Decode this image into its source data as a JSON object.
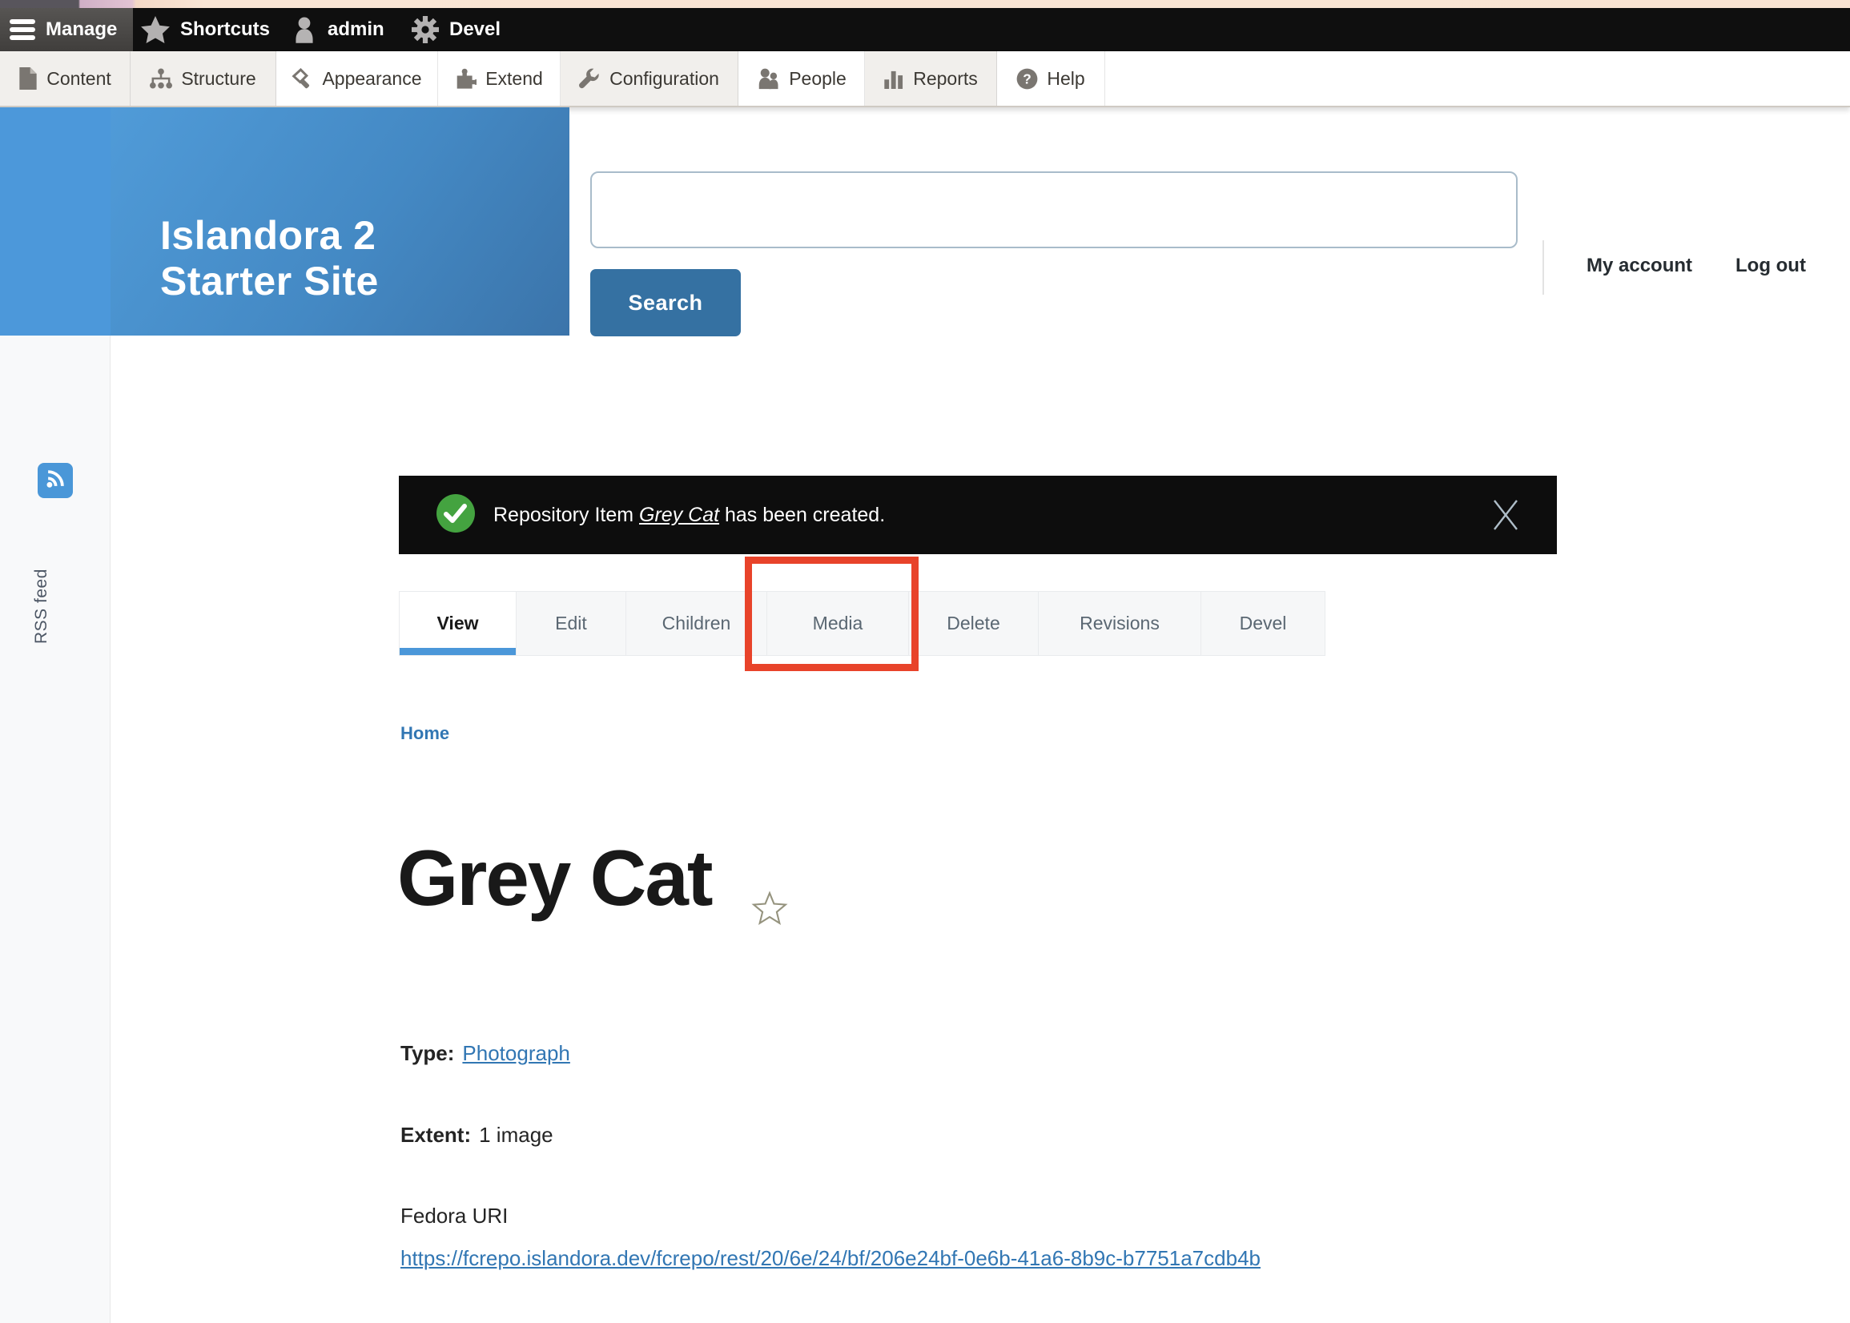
{
  "admin_bar": {
    "items": [
      {
        "label": "Manage",
        "icon": "hamburger-icon"
      },
      {
        "label": "Shortcuts",
        "icon": "star-icon"
      },
      {
        "label": "admin",
        "icon": "user-icon"
      },
      {
        "label": "Devel",
        "icon": "gear-icon"
      }
    ]
  },
  "toolbar": {
    "items": [
      {
        "label": "Content",
        "icon": "document-icon"
      },
      {
        "label": "Structure",
        "icon": "sitemap-icon"
      },
      {
        "label": "Appearance",
        "icon": "paintbrush-icon"
      },
      {
        "label": "Extend",
        "icon": "puzzle-icon"
      },
      {
        "label": "Configuration",
        "icon": "wrench-icon"
      },
      {
        "label": "People",
        "icon": "people-icon"
      },
      {
        "label": "Reports",
        "icon": "barchart-icon"
      },
      {
        "label": "Help",
        "icon": "question-circle-icon"
      }
    ]
  },
  "header": {
    "site_name": "Islandora 2 Starter Site",
    "search_value": "",
    "search_button": "Search",
    "my_account": "My account",
    "log_out": "Log out"
  },
  "sidebar": {
    "rss_label": "RSS feed",
    "rss_icon": "rss-icon"
  },
  "notification": {
    "icon": "check-circle-icon",
    "prefix": "Repository Item ",
    "link_text": "Grey Cat",
    "suffix": " has been created.",
    "close_icon": "close-icon"
  },
  "tabs": {
    "items": [
      {
        "label": "View",
        "active": true
      },
      {
        "label": "Edit",
        "active": false
      },
      {
        "label": "Children",
        "active": false
      },
      {
        "label": "Media",
        "active": false
      },
      {
        "label": "Delete",
        "active": false
      },
      {
        "label": "Revisions",
        "active": false
      },
      {
        "label": "Devel",
        "active": false
      }
    ],
    "highlighted_tab": "Media"
  },
  "breadcrumb": {
    "home": "Home"
  },
  "content": {
    "title": "Grey Cat",
    "favorite_icon": "star-outline-icon",
    "type_label": "Type:",
    "type_value": "Photograph",
    "extent_label": "Extent:",
    "extent_value": "1 image",
    "fedora_label": "Fedora URI",
    "fedora_url": "https://fcrepo.islandora.dev/fcrepo/rest/20/6e/24/bf/206e24bf-0e6b-41a6-8b9c-b7751a7cdb4b"
  },
  "colors": {
    "admin_bar_bg": "#0f0f0f",
    "header_blue_light": "#509bd8",
    "header_blue_dark": "#3b74aa",
    "search_button_blue": "#3571a2",
    "active_tab_blue": "#4b97d9",
    "link_blue": "#3176b3",
    "notification_bg": "#0d0d0d",
    "success_green": "#44a340",
    "highlight_red": "#e8432a",
    "rss_blue": "#4a97d8"
  }
}
